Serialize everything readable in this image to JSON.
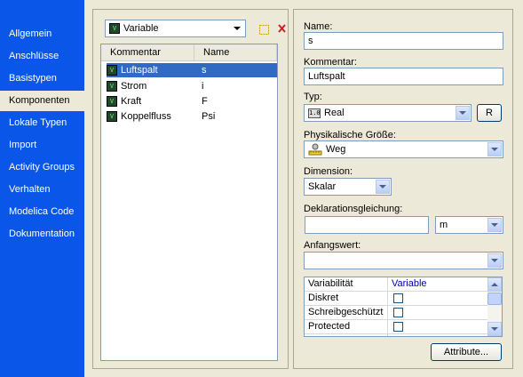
{
  "sidebar": {
    "items": [
      {
        "label": "Allgemein"
      },
      {
        "label": "Anschlüsse"
      },
      {
        "label": "Basistypen"
      },
      {
        "label": "Komponenten",
        "active": true
      },
      {
        "label": "Lokale Typen"
      },
      {
        "label": "Import"
      },
      {
        "label": "Activity Groups"
      },
      {
        "label": "Verhalten"
      },
      {
        "label": "Modelica Code"
      },
      {
        "label": "Dokumentation"
      }
    ]
  },
  "components": {
    "filter_value": "Variable",
    "columns": [
      "Kommentar",
      "Name"
    ],
    "rows": [
      {
        "kommentar": "Luftspalt",
        "name": "s",
        "selected": true
      },
      {
        "kommentar": "Strom",
        "name": "i"
      },
      {
        "kommentar": "Kraft",
        "name": "F"
      },
      {
        "kommentar": "Koppelfluss",
        "name": "Psi"
      }
    ]
  },
  "form": {
    "name_label": "Name:",
    "name_value": "s",
    "comment_label": "Kommentar:",
    "comment_value": "Luftspalt",
    "type_label": "Typ:",
    "type_value": "Real",
    "type_button": "R",
    "quantity_label": "Physikalische Größe:",
    "quantity_value": "Weg",
    "dimension_label": "Dimension:",
    "dimension_value": "Skalar",
    "declaration_label": "Deklarationsgleichung:",
    "declaration_value": "",
    "unit_value": "m",
    "initial_label": "Anfangswert:",
    "initial_value": "",
    "properties": [
      {
        "key": "Variabilität",
        "value": "Variable"
      },
      {
        "key": "Diskret"
      },
      {
        "key": "Schreibgeschützt"
      },
      {
        "key": "Protected"
      }
    ],
    "attribute_button": "Attribute..."
  },
  "colors": {
    "sidebar": "#0a56e8",
    "selection": "#316ac5",
    "background": "#ece9d8"
  }
}
